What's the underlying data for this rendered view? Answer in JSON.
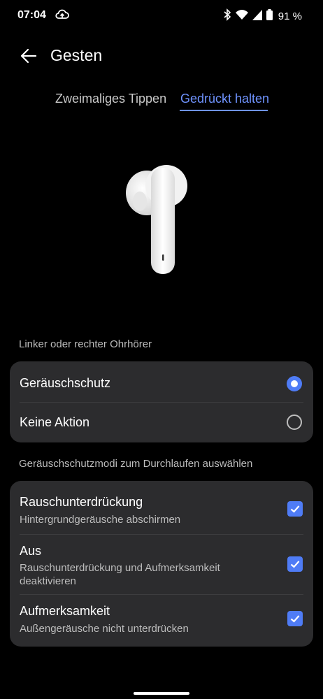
{
  "status_bar": {
    "time": "07:04",
    "battery": "91 %",
    "icons": [
      "cloud-upload-icon",
      "bluetooth-icon",
      "wifi-icon",
      "signal-icon",
      "battery-icon"
    ]
  },
  "header": {
    "title": "Gesten",
    "back_icon": "arrow-left-icon"
  },
  "tabs": [
    {
      "label": "Zweimaliges Tippen",
      "selected": false
    },
    {
      "label": "Gedrückt halten",
      "selected": true
    }
  ],
  "section1": {
    "label": "Linker oder rechter Ohrhörer",
    "options": [
      {
        "label": "Geräuschschutz",
        "selected": true
      },
      {
        "label": "Keine Aktion",
        "selected": false
      }
    ]
  },
  "section2": {
    "label": "Geräuschschutzmodi zum Durchlaufen auswählen",
    "items": [
      {
        "title": "Rauschunterdrückung",
        "subtitle": "Hintergrundgeräusche abschirmen",
        "checked": true
      },
      {
        "title": "Aus",
        "subtitle": "Rauschunterdrückung und Aufmerksamkeit deaktivieren",
        "checked": true
      },
      {
        "title": "Aufmerksamkeit",
        "subtitle": "Außengeräusche nicht unterdrücken",
        "checked": true
      }
    ]
  },
  "colors": {
    "accent": "#4f7cf6",
    "tab_active": "#6f93ff",
    "card": "#2c2c2e",
    "background": "#000000"
  }
}
